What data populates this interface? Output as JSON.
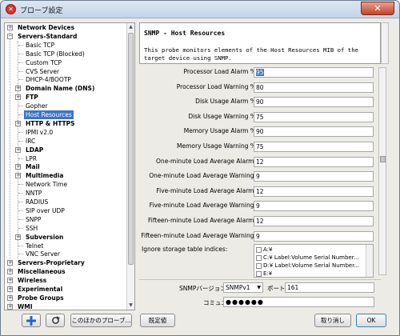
{
  "window": {
    "title": "プローブ設定",
    "close_glyph": "✕",
    "app_icon_glyph": "✕"
  },
  "tree": {
    "items": [
      {
        "label": "Network Devices",
        "level": 0,
        "expander": "+",
        "bold": true
      },
      {
        "label": "Servers-Standard",
        "level": 0,
        "expander": "−",
        "bold": true
      },
      {
        "label": "Basic TCP",
        "level": 1
      },
      {
        "label": "Basic TCP (Blocked)",
        "level": 1
      },
      {
        "label": "Custom TCP",
        "level": 1
      },
      {
        "label": "CVS Server",
        "level": 1
      },
      {
        "label": "DHCP-4/BOOTP",
        "level": 1
      },
      {
        "label": "Domain Name (DNS)",
        "level": 1,
        "expander": "+",
        "bold": true
      },
      {
        "label": "FTP",
        "level": 1,
        "expander": "+",
        "bold": true
      },
      {
        "label": "Gopher",
        "level": 1
      },
      {
        "label": "Host Resources",
        "level": 1,
        "selected": true
      },
      {
        "label": "HTTP & HTTPS",
        "level": 1,
        "expander": "+",
        "bold": true
      },
      {
        "label": "IPMI v2.0",
        "level": 1
      },
      {
        "label": "IRC",
        "level": 1
      },
      {
        "label": "LDAP",
        "level": 1,
        "expander": "+",
        "bold": true
      },
      {
        "label": "LPR",
        "level": 1
      },
      {
        "label": "Mail",
        "level": 1,
        "expander": "+",
        "bold": true
      },
      {
        "label": "Multimedia",
        "level": 1,
        "expander": "+",
        "bold": true
      },
      {
        "label": "Network Time",
        "level": 1
      },
      {
        "label": "NNTP",
        "level": 1
      },
      {
        "label": "RADIUS",
        "level": 1
      },
      {
        "label": "SIP over UDP",
        "level": 1
      },
      {
        "label": "SNPP",
        "level": 1
      },
      {
        "label": "SSH",
        "level": 1
      },
      {
        "label": "Subversion",
        "level": 1,
        "expander": "+",
        "bold": true
      },
      {
        "label": "Telnet",
        "level": 1
      },
      {
        "label": "VNC Server",
        "level": 1
      },
      {
        "label": "Servers-Proprietary",
        "level": 0,
        "expander": "+",
        "bold": true
      },
      {
        "label": "Miscellaneous",
        "level": 0,
        "expander": "+",
        "bold": true
      },
      {
        "label": "Wireless",
        "level": 0,
        "expander": "+",
        "bold": true
      },
      {
        "label": "Experimental",
        "level": 0,
        "expander": "+",
        "bold": true
      },
      {
        "label": "Probe Groups",
        "level": 0,
        "expander": "+",
        "bold": true
      },
      {
        "label": "WMI",
        "level": 0,
        "expander": "+",
        "bold": true
      }
    ]
  },
  "left_buttons": {
    "add_icon": "plus-icon",
    "refresh_icon": "refresh-icon",
    "other_probe": "このほかのプローブ..."
  },
  "header": {
    "title": "SNMP - Host Resources",
    "description": "This probe monitors elements of the Host Resources MIB of the target device using SNMP."
  },
  "fields": [
    {
      "label": "Processor Load Alarm %",
      "value": "95",
      "focused": true
    },
    {
      "label": "Processor Load Warning %",
      "value": "80"
    },
    {
      "label": "Disk Usage Alarm %",
      "value": "90"
    },
    {
      "label": "Disk Usage Warning %",
      "value": "75"
    },
    {
      "label": "Memory Usage Alarm %",
      "value": "90"
    },
    {
      "label": "Memory Usage Warning %",
      "value": "75"
    },
    {
      "label": "One-minute Load Average Alarm:",
      "value": "12"
    },
    {
      "label": "One-minute Load Average Warning:",
      "value": "9"
    },
    {
      "label": "Five-minute Load Average Alarm:",
      "value": "12"
    },
    {
      "label": "Five-minute Load Average Warning:",
      "value": "9"
    },
    {
      "label": "Fifteen-minute Load Average Alarm:",
      "value": "12"
    },
    {
      "label": "Fifteen-minute Load Average Warning:",
      "value": "9"
    }
  ],
  "ignore_storage": {
    "label": "Ignore storage table indices:",
    "items": [
      "A:¥",
      "C:¥ Label:Volume  Serial Number...",
      "D:¥ Label:Volume  Serial Number...",
      "E:¥"
    ]
  },
  "snmp": {
    "version_label": "SNMPバージョン",
    "version_value": "SNMPv1",
    "port_label": "ポート",
    "port_value": "161",
    "community_label": "コミュニティ",
    "community_value": "●●●●●●"
  },
  "footer": {
    "default_button": "既定値",
    "cancel_button": "取り消し",
    "ok_button": "OK"
  }
}
